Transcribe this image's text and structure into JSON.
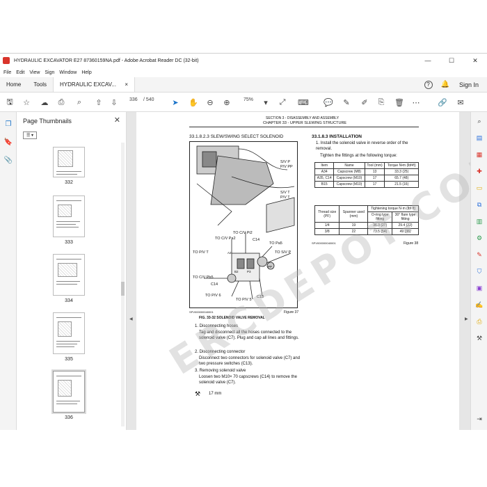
{
  "window": {
    "title": "HYDRAULIC EXCAVATOR E27 87360159NA.pdf - Adobe Acrobat Reader DC (32-bit)",
    "controls": [
      "—",
      "☐",
      "✕"
    ]
  },
  "menu": [
    "File",
    "Edit",
    "View",
    "Sign",
    "Window",
    "Help"
  ],
  "tabs": {
    "home": "Home",
    "tools": "Tools",
    "document": "HYDRAULIC EXCAV...",
    "document_close": "×",
    "help": "?",
    "sign_in": "Sign In"
  },
  "toolbar": {
    "current_page": "336",
    "total_pages": "/ 540",
    "zoom": "75%"
  },
  "thumbnails": {
    "header": "Page Thumbnails",
    "close": "✕",
    "options": "☰ ▾",
    "pages": [
      "332",
      "333",
      "334",
      "335",
      "336"
    ],
    "selected": "336"
  },
  "page": {
    "header_line1": "SECTION 3 - DISASSEMBLY AND ASSEMBLY",
    "header_line2": "CHAPTER 33 - UPPER SLEWING STRUCTURE",
    "left_title": "33.1.8.2.3  SLEW/SWING SELECT SOLENOID",
    "figure_labels": {
      "sv_p": "S/V P",
      "pv_pp": "P/V PP",
      "sv_t": "S/V T",
      "pv_t": "P/V T",
      "cv_pi2": "TO C/V Pi2",
      "cv_pa2": "TO C/V Pa2",
      "c14a": "C14",
      "pa5": "TO Pa5",
      "pv_t2": "TO P/V T",
      "sv_p2": "TO S/V P",
      "a2": "A2",
      "pp": "PP",
      "cv_pb5": "TO C/V Pb5",
      "c14b": "C14",
      "b2": "B2",
      "p3": "P3",
      "pv6": "TO P/V 6",
      "pv5": "TO P/V 5",
      "c13": "C13"
    },
    "figure_code": "SPV000000040001",
    "figure_num": "Figure 37",
    "figure_caption": "FIG. 33-32 SOLENOID VALVE REMOVAL",
    "steps": [
      "1. Disconnecting hoses",
      "Tag and disconnect all the hoses connected to the solenoid valve (C7). Plug and cap all lines and fittings.",
      "2. Disconnecting connector",
      "Disconnect two connectors for solenoid valve (C7) and two pressure switches (C13).",
      "3. Removing solenoid valve",
      "Loosen two M10× 70 capscrews (C14) to remove the solenoid valve (C7)."
    ],
    "wrench": "17 mm",
    "right_title": "33.1.8.3  INSTALLATION",
    "install_1": "1. Install the solenoid valve in reverse order of the removal.",
    "install_2": "Tighten the fittings at the following torque:",
    "torque_headers": [
      "Item",
      "Name",
      "Tool (mm)",
      "Torque N•m (lbf•ft)"
    ],
    "torque_rows": [
      [
        "A34",
        "Capscrew (M8)",
        "13",
        "33.3 (25)"
      ],
      [
        "A35, C14",
        "Capscrew (M10)",
        "17",
        "65.7 (48)"
      ],
      [
        "B15",
        "Capscrew (M10)",
        "17",
        "21.5 (16)"
      ]
    ],
    "fit_header": "Tightening torque N·m (lbf·ft)",
    "fit_cols": [
      "Thread size (PF)",
      "Spanner used (mm)",
      "O-ring type fitting",
      "30° flare type fitting"
    ],
    "fit_rows": [
      [
        "1/4",
        "19",
        "36.3 (27)",
        "29.4 (22)"
      ],
      [
        "3/8",
        "22",
        "73.5 (54)",
        "49 (36)"
      ]
    ],
    "table_code": "SPV000000040001",
    "table_fig": "Figure 38",
    "watermark": "ERCDEPOT.COM"
  }
}
